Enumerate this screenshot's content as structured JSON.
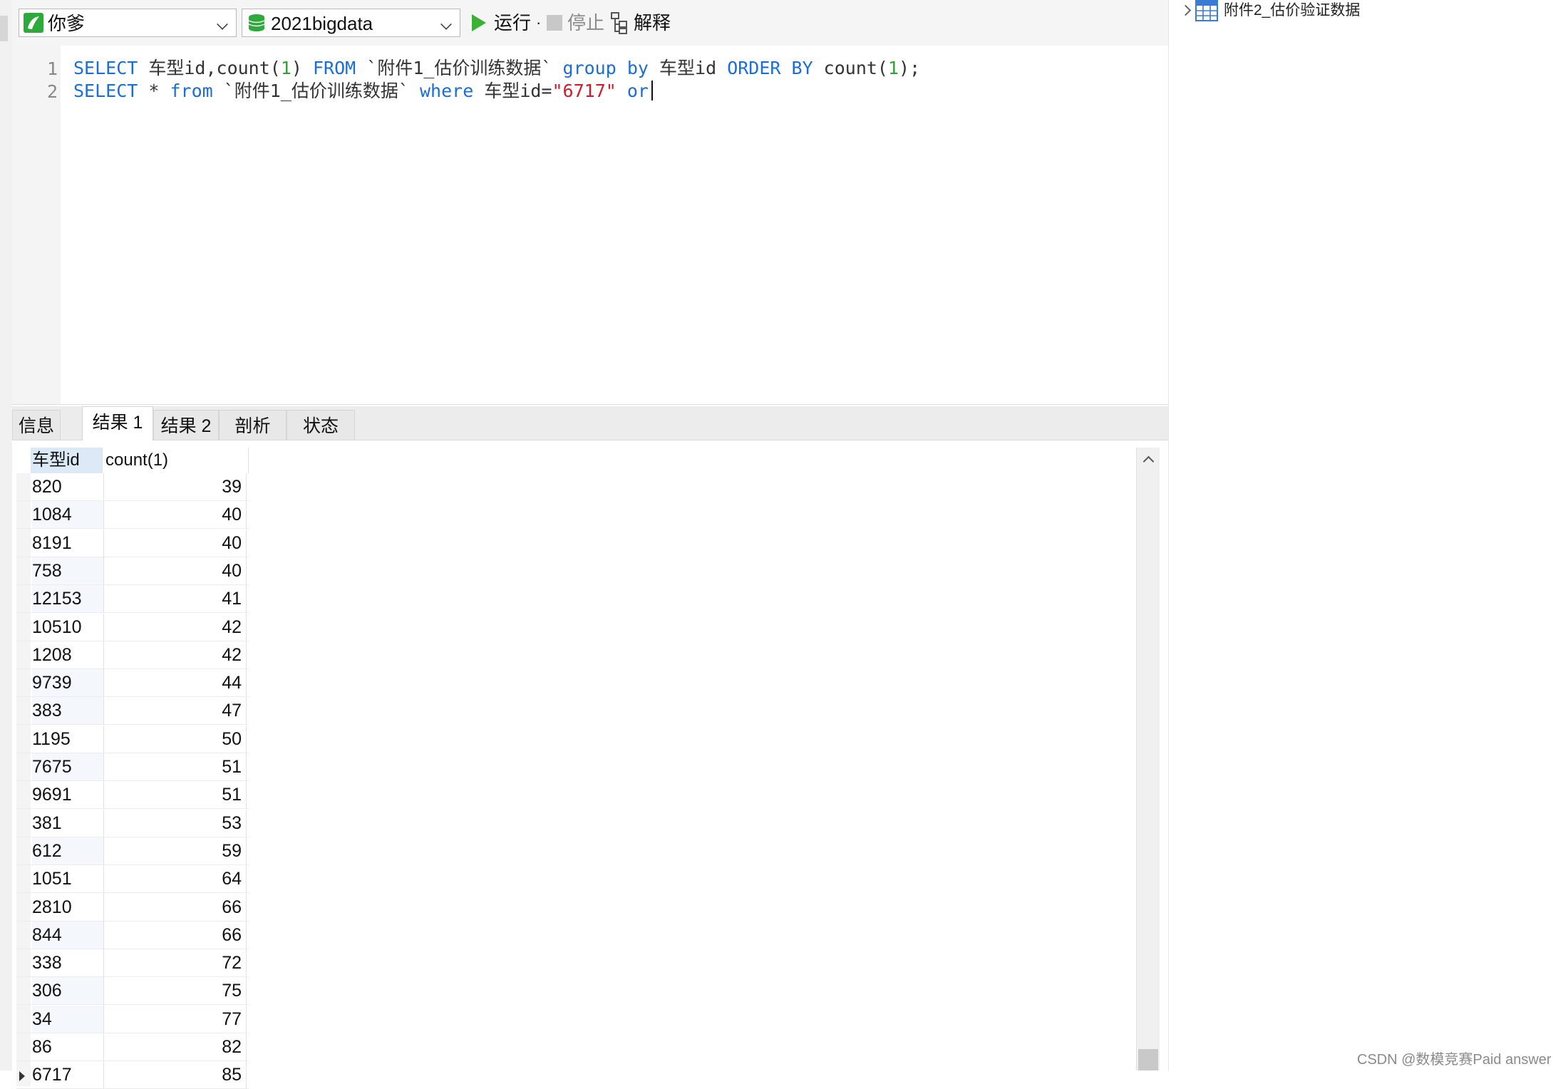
{
  "toolbar": {
    "connection": "你爹",
    "database": "2021bigdata",
    "run_label": "运行",
    "run_more": "·",
    "stop_label": "停止",
    "explain_label": "解释"
  },
  "tree": {
    "table_name": "附件2_估价验证数据"
  },
  "editor": {
    "line_numbers": [
      "1",
      "2"
    ],
    "line1": [
      {
        "t": "SELECT",
        "c": "kw"
      },
      {
        "t": " 车型id,count(",
        "c": "plain"
      },
      {
        "t": "1",
        "c": "num"
      },
      {
        "t": ") ",
        "c": "plain"
      },
      {
        "t": "FROM",
        "c": "kw"
      },
      {
        "t": " `附件1_估价训练数据` ",
        "c": "plain"
      },
      {
        "t": "group",
        "c": "kw"
      },
      {
        "t": " ",
        "c": "plain"
      },
      {
        "t": "by",
        "c": "kw"
      },
      {
        "t": " 车型id ",
        "c": "plain"
      },
      {
        "t": "ORDER",
        "c": "kw"
      },
      {
        "t": " ",
        "c": "plain"
      },
      {
        "t": "BY",
        "c": "kw"
      },
      {
        "t": " count(",
        "c": "plain"
      },
      {
        "t": "1",
        "c": "num"
      },
      {
        "t": ");",
        "c": "plain"
      }
    ],
    "line2": [
      {
        "t": "SELECT",
        "c": "kw"
      },
      {
        "t": " * ",
        "c": "plain"
      },
      {
        "t": "from",
        "c": "kw"
      },
      {
        "t": " `附件1_估价训练数据` ",
        "c": "plain"
      },
      {
        "t": "where",
        "c": "kw"
      },
      {
        "t": " 车型id=",
        "c": "plain"
      },
      {
        "t": "\"6717\"",
        "c": "str"
      },
      {
        "t": " ",
        "c": "plain"
      },
      {
        "t": "or",
        "c": "kw"
      }
    ]
  },
  "tabs": [
    "信息",
    "结果 1",
    "结果 2",
    "剖析",
    "状态"
  ],
  "active_tab": "结果 1",
  "grid": {
    "columns": [
      "车型id",
      "count(1)"
    ],
    "rows": [
      [
        "820",
        "39"
      ],
      [
        "1084",
        "40"
      ],
      [
        "8191",
        "40"
      ],
      [
        "758",
        "40"
      ],
      [
        "12153",
        "41"
      ],
      [
        "10510",
        "42"
      ],
      [
        "1208",
        "42"
      ],
      [
        "9739",
        "44"
      ],
      [
        "383",
        "47"
      ],
      [
        "1195",
        "50"
      ],
      [
        "7675",
        "51"
      ],
      [
        "9691",
        "51"
      ],
      [
        "381",
        "53"
      ],
      [
        "612",
        "59"
      ],
      [
        "1051",
        "64"
      ],
      [
        "2810",
        "66"
      ],
      [
        "844",
        "66"
      ],
      [
        "338",
        "72"
      ],
      [
        "306",
        "75"
      ],
      [
        "34",
        "77"
      ],
      [
        "86",
        "82"
      ],
      [
        "6717",
        "85"
      ]
    ],
    "selected_row": "6717"
  },
  "watermark": "CSDN @数模竞赛Paid answer",
  "colors": {
    "keyword": "#1a6ed8",
    "number": "#2fa32f",
    "string": "#d11a2a",
    "run": "#3cb035"
  }
}
